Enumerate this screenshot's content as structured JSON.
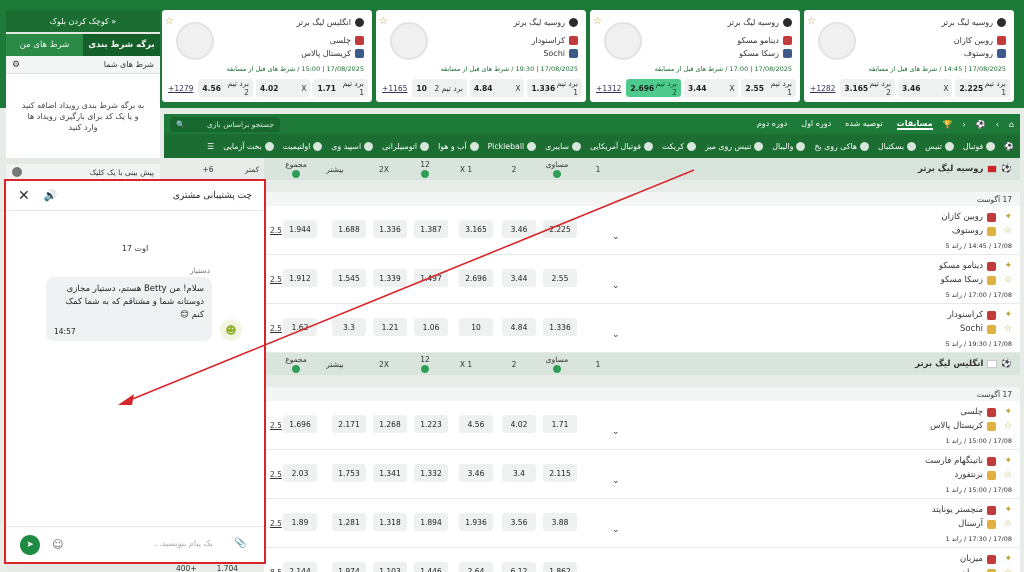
{
  "sidebar": {
    "compact_label": "کوچک کردن بلوک »",
    "tab_betslip": "برگه شرط بندی",
    "tab_mybets": "شرط های من",
    "bets_header": "شرط های شما",
    "empty_text": "به برگه شرط بندی رویداد اضافه کنید و یا یک کد برای بارگیری رویداد ها وارد کنید",
    "oneclick_label": "پیش بینی با یک کلیک"
  },
  "cards": [
    {
      "league": "انگلیس لیگ برتر",
      "team1": "چلسی",
      "team2": "کریستال پالاس",
      "meta": "17/08/2025 | 15:00 / شرط های قبل از مسابقه",
      "o1": "1.71",
      "x": "4.02",
      "o2": "4.56",
      "w1": "برد تیم 1",
      "xl": "X",
      "w2": "برد تیم 2",
      "more": "1279+",
      "hl": false
    },
    {
      "league": "روسیه لیگ برتر",
      "team1": "کراسنودار",
      "team2": "Sochi",
      "meta": "17/08/2025 | 19:30 / شرط های قبل از مسابقه",
      "o1": "1.336",
      "x": "4.84",
      "o2": "10",
      "w1": "برد تیم 1",
      "xl": "X",
      "w2": "برد تیم 2",
      "more": "1165+",
      "hl": false
    },
    {
      "league": "روسیه لیگ برتر",
      "team1": "دینامو مسکو",
      "team2": "زسکا مسکو",
      "meta": "17/08/2025 | 17:00 / شرط های قبل از مسابقه",
      "o1": "2.55",
      "x": "3.44",
      "o2": "2.696",
      "w1": "برد تیم 1",
      "xl": "X",
      "w2": "برد تیم 2",
      "more": "1312+",
      "hl": true
    },
    {
      "league": "روسیه لیگ برتر",
      "team1": "روبین کازان",
      "team2": "روستوف",
      "meta": "17/08/2025 | 14:45 / شرط های قبل از مسابقه",
      "o1": "2.225",
      "x": "3.46",
      "o2": "3.165",
      "w1": "برد تیم 1",
      "xl": "X",
      "w2": "برد تیم 2",
      "more": "1282+",
      "hl": false
    }
  ],
  "nav1": {
    "items": [
      "مسابقات",
      "توصیه شده",
      "دوره اول",
      "دوره دوم"
    ],
    "search_placeholder": "جستجو براساس بازی"
  },
  "nav2": [
    "فوتبال",
    "تنیس",
    "بسکتبال",
    "هاکی روی یخ",
    "والیبال",
    "تنیس روی میز",
    "کریکت",
    "فوتبال آمریکایی",
    "سایبری",
    "Pickleball",
    "آب و هوا",
    "اتومبیلرانی",
    "اسپید وی",
    "اولتیمیت",
    "بخت آزمایی"
  ],
  "columns": [
    "1",
    "مساوی",
    "2",
    "1 X",
    "12",
    "2X",
    "بیشتر",
    "مجموع",
    "کمتر",
    "6+"
  ],
  "leagues": [
    {
      "name": "روسیه لیگ برتر",
      "date": "17 آگوست",
      "matches": [
        {
          "team1": "روبین کازان",
          "team2": "روستوف",
          "meta": "17/08 / 14:45 / راند 5",
          "odds": [
            "2.225",
            "3.46",
            "3.165",
            "1.387",
            "1.336",
            "1.688",
            "1.944"
          ],
          "total": "2.5"
        },
        {
          "team1": "دینامو مسکو",
          "team2": "زسکا مسکو",
          "meta": "17/08 / 17:00 / راند 5",
          "odds": [
            "2.55",
            "3.44",
            "2.696",
            "1.497",
            "1.339",
            "1.545",
            "1.912"
          ],
          "total": "2.5"
        },
        {
          "team1": "کراسنودار",
          "team2": "Sochi",
          "meta": "17/08 / 19:30 / راند 5",
          "odds": [
            "1.336",
            "4.84",
            "10",
            "1.06",
            "1.21",
            "3.3",
            "1.62"
          ],
          "total": "2.5"
        }
      ]
    },
    {
      "name": "انگلیس لیگ برتر",
      "date": "17 آگوست",
      "matches": [
        {
          "team1": "چلسی",
          "team2": "کریستال پالاس",
          "meta": "17/08 / 15:00 / راند 1",
          "odds": [
            "1.71",
            "4.02",
            "4.56",
            "1.223",
            "1.268",
            "2.171",
            "1.696"
          ],
          "total": "2.5"
        },
        {
          "team1": "ناتینگهام فارست",
          "team2": "برنتفورد",
          "meta": "17/08 / 15:00 / راند 1",
          "odds": [
            "2.115",
            "3.4",
            "3.46",
            "1.332",
            "1.341",
            "1.753",
            "2.03"
          ],
          "total": "2.5"
        },
        {
          "team1": "منچستر یونایتد",
          "team2": "آرسنال",
          "meta": "17/08 / 17:30 / راند 1",
          "odds": [
            "3.88",
            "3.56",
            "1.936",
            "1.894",
            "1.318",
            "1.281",
            "1.89"
          ],
          "total": "2.5"
        },
        {
          "team1": "میزبان",
          "team2": "مهمان",
          "meta": "",
          "odds": [
            "1.862",
            "6.12",
            "2.64",
            "1.446",
            "1.103",
            "1.974",
            "2.144"
          ],
          "total": "8.5"
        }
      ]
    }
  ],
  "partial_row": {
    "a": "400+",
    "b": "1.704"
  },
  "chat": {
    "title": "چت پشتیبانی مشتری",
    "date": "17 اوت",
    "agent": "دستیار",
    "message": "سلام! من Betty هستم، دستیار مجازی دوستانه شما و مشتاقم که به شما کمک کنم 😊",
    "time": "14:57",
    "input_placeholder": "یک پیام بنویسید..."
  },
  "colors": {
    "brand": "#1d7a38",
    "accent": "#4ecb8c",
    "annotation": "#d7262b"
  }
}
